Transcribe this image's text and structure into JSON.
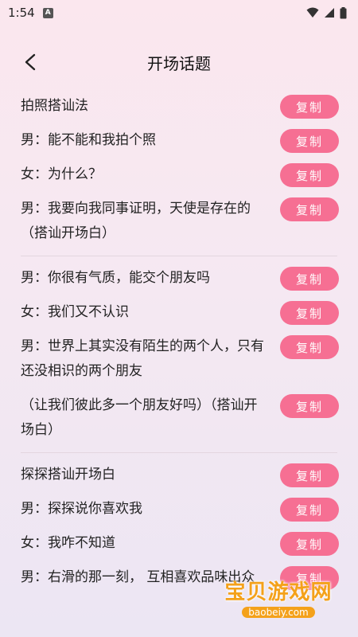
{
  "status_bar": {
    "time": "1:54",
    "app_icon_letter": "A"
  },
  "header": {
    "title": "开场话题"
  },
  "groups": [
    {
      "rows": [
        {
          "text": "拍照搭讪法",
          "copy": "复制"
        },
        {
          "text": "男：能不能和我拍个照",
          "copy": "复制"
        },
        {
          "text": "女：为什么？",
          "copy": "复制"
        },
        {
          "text": "男：我要向我同事证明，天使是存在的（搭讪开场白）",
          "copy": "复制"
        }
      ]
    },
    {
      "rows": [
        {
          "text": "男：你很有气质，能交个朋友吗",
          "copy": "复制"
        },
        {
          "text": "女：我们又不认识",
          "copy": "复制"
        },
        {
          "text": "男：世界上其实没有陌生的两个人，只有还没相识的两个朋友",
          "copy": "复制"
        },
        {
          "text": "（让我们彼此多一个朋友好吗）（搭讪开场白）",
          "copy": "复制"
        }
      ]
    },
    {
      "rows": [
        {
          "text": "探探搭讪开场白",
          "copy": "复制"
        },
        {
          "text": "男：探探说你喜欢我",
          "copy": "复制"
        },
        {
          "text": "女：我咋不知道",
          "copy": "复制"
        },
        {
          "text": "男：右滑的那一刻， 互相喜欢品味出众",
          "copy": "复制"
        }
      ]
    }
  ],
  "watermark": {
    "main": "宝贝游戏网",
    "sub": "baobeiy.com"
  },
  "colors": {
    "accent": "#f66f93"
  }
}
